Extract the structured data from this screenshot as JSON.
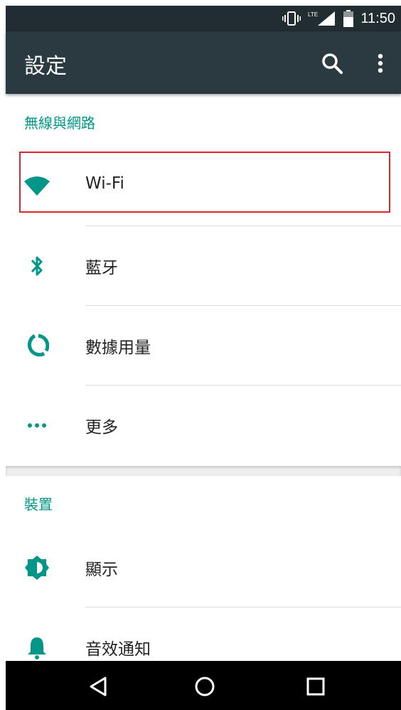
{
  "status_bar": {
    "time": "11:50",
    "network": "LTE"
  },
  "app_bar": {
    "title": "設定"
  },
  "sections": [
    {
      "header": "無線與網路"
    },
    {
      "header": "裝置"
    }
  ],
  "items": {
    "wifi": "Wi-Fi",
    "bluetooth": "藍牙",
    "data_usage": "數據用量",
    "more": "更多",
    "display": "顯示",
    "sound": "音效通知"
  },
  "colors": {
    "accent": "#009688",
    "appbar": "#2b3a40",
    "statusbar": "#212d31",
    "highlight": "#e0272e"
  }
}
